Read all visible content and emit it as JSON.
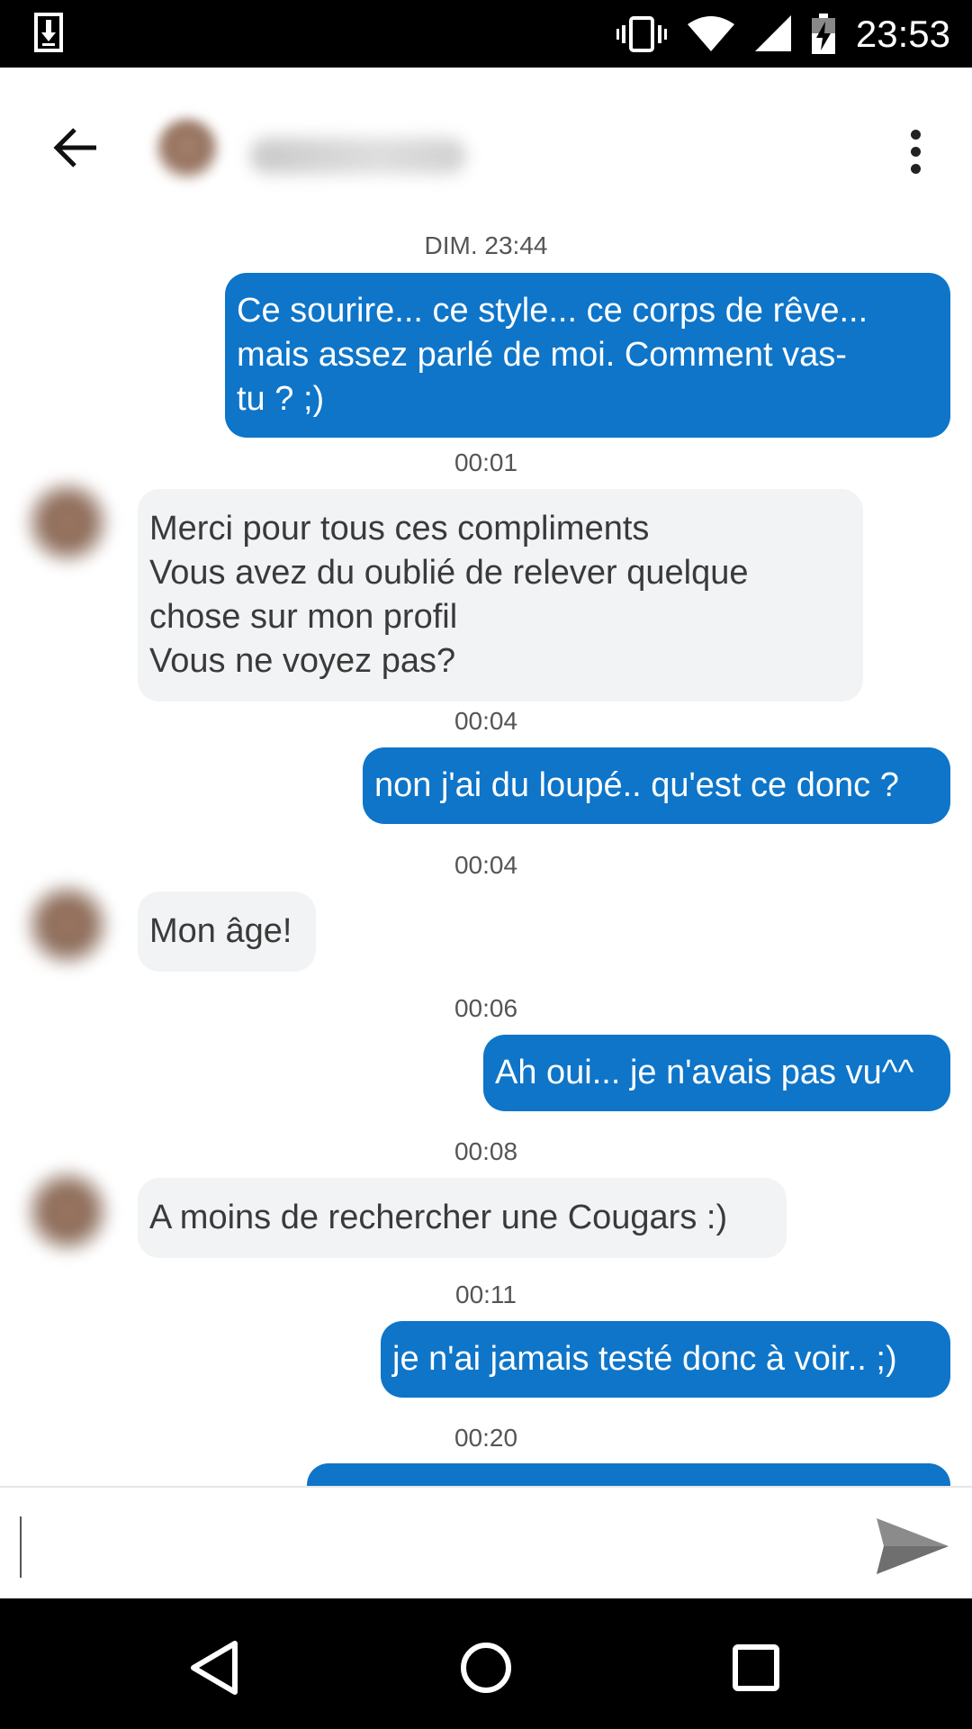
{
  "status_bar": {
    "time": "23:53",
    "icons": [
      "download-icon",
      "vibrate-icon",
      "wifi-icon",
      "signal-icon",
      "battery-charging-icon"
    ]
  },
  "header": {
    "contact_name": "",
    "icons": {
      "back": "arrow-back-icon",
      "menu": "more-vert-icon"
    }
  },
  "conversation": {
    "day_label": "DIM. 23:44",
    "messages": [
      {
        "time": "",
        "from": "me",
        "text": "Ce sourire... ce style... ce corps de rêve...\nmais assez parlé de moi. Comment vas-\ntu ? ;)"
      },
      {
        "time": "00:01",
        "from": "them",
        "text": "Merci pour tous ces compliments\nVous avez du oublié de relever quelque\nchose sur mon profil\nVous ne voyez pas?"
      },
      {
        "time": "00:04",
        "from": "me",
        "text": "non j'ai du loupé.. qu'est ce donc ?"
      },
      {
        "time": "00:04",
        "from": "them",
        "text": "Mon âge!"
      },
      {
        "time": "00:06",
        "from": "me",
        "text": "Ah oui... je n'avais pas vu^^"
      },
      {
        "time": "00:08",
        "from": "them",
        "text": "A moins de rechercher une Cougars :)"
      },
      {
        "time": "00:11",
        "from": "me",
        "text": "je n'ai jamais testé donc à voir.. ;)"
      },
      {
        "time": "00:20",
        "from": "me",
        "text": ""
      }
    ]
  },
  "composer": {
    "placeholder": "",
    "value": "",
    "send_icon": "send-icon"
  },
  "nav_bar": {
    "icons": [
      "back-triangle-icon",
      "home-circle-icon",
      "recents-square-icon"
    ]
  },
  "colors": {
    "outgoing_bubble": "#0e75c9",
    "incoming_bubble": "#f2f3f5",
    "status_bar": "#000000"
  }
}
